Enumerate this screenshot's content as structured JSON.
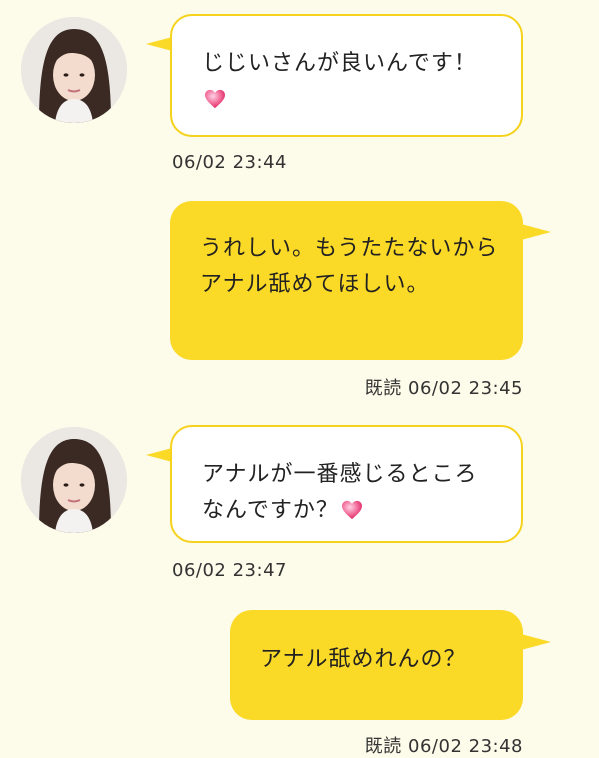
{
  "messages": [
    {
      "direction": "incoming",
      "text": "じじいさんが良いんです！",
      "emoji": "pink-heart-icon",
      "timestamp": "06/02 23:44",
      "read_label": ""
    },
    {
      "direction": "outgoing",
      "text": "うれしい。もうたたないからアナル舐めてほしい。",
      "emoji": "",
      "timestamp": "06/02 23:45",
      "read_label": "既読"
    },
    {
      "direction": "incoming",
      "text": "アナルが一番感じるところなんですか？",
      "emoji": "pink-heart-icon",
      "timestamp": "06/02 23:47",
      "read_label": ""
    },
    {
      "direction": "outgoing",
      "text": "アナル舐めれんの？",
      "emoji": "",
      "timestamp": "06/02 23:48",
      "read_label": "既読"
    }
  ],
  "colors": {
    "background": "#fdfbe9",
    "outgoing_bubble": "#fbd927",
    "incoming_border": "#f5d21c",
    "heart": "#f06292"
  }
}
